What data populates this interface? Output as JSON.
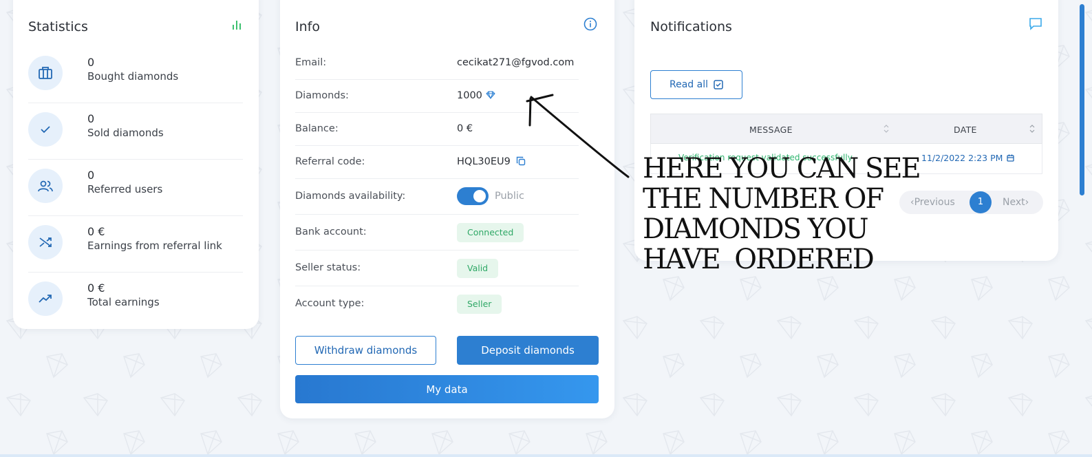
{
  "colors": {
    "accent": "#2d7fd1",
    "badge_bg": "#e6f6ec",
    "badge_text": "#2fa866",
    "background": "#f2f5f9"
  },
  "statistics": {
    "title": "Statistics",
    "header_icon": "bar-chart-icon",
    "items": [
      {
        "value": "0",
        "label": "Bought diamonds",
        "icon": "briefcase-icon"
      },
      {
        "value": "0",
        "label": "Sold diamonds",
        "icon": "check-icon"
      },
      {
        "value": "0",
        "label": "Referred users",
        "icon": "users-icon"
      },
      {
        "value": "0 €",
        "label": "Earnings from referral link",
        "icon": "shuffle-icon"
      },
      {
        "value": "0 €",
        "label": "Total earnings",
        "icon": "trending-up-icon"
      }
    ]
  },
  "info": {
    "title": "Info",
    "header_icon": "info-icon",
    "rows": {
      "email": {
        "label": "Email:",
        "value": "cecikat271@fgvod.com"
      },
      "diamonds": {
        "label": "Diamonds:",
        "value": "1000"
      },
      "balance": {
        "label": "Balance:",
        "value": "0 €"
      },
      "referral": {
        "label": "Referral code:",
        "value": "HQL30EU9"
      },
      "availability": {
        "label": "Diamonds availability:",
        "value": "Public"
      },
      "bank": {
        "label": "Bank account:",
        "value": "Connected"
      },
      "seller_status": {
        "label": "Seller status:",
        "value": "Valid"
      },
      "account_type": {
        "label": "Account type:",
        "value": "Seller"
      }
    },
    "buttons": {
      "withdraw": "Withdraw diamonds",
      "deposit": "Deposit diamonds",
      "my_data": "My data"
    }
  },
  "notifications": {
    "title": "Notifications",
    "header_icon": "chat-icon",
    "read_all": "Read all",
    "columns": [
      "MESSAGE",
      "DATE"
    ],
    "rows": [
      {
        "message": "Verification request validated successfully",
        "date": "11/2/2022 2:23 PM"
      }
    ],
    "pager": {
      "previous": "Previous",
      "current": "1",
      "next": "Next"
    }
  },
  "annotation": {
    "lines": [
      "HERE YOU CAN SEE",
      "THE NUMBER OF",
      "DIAMONDS YOU",
      "HAVE  ORDERED"
    ]
  }
}
